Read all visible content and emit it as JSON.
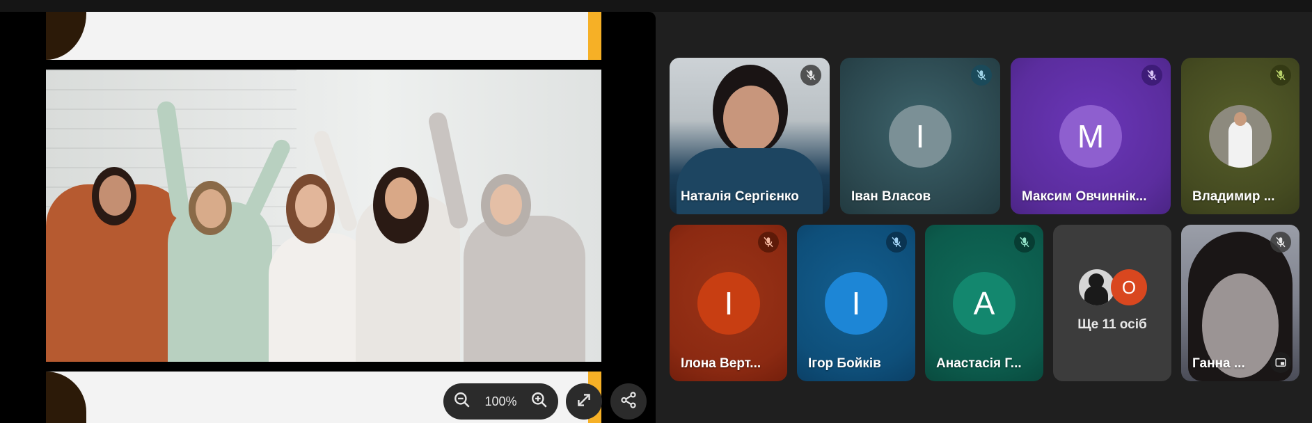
{
  "presentation": {
    "zoom_level": "100%",
    "colors": {
      "slide_bg": "#f3f3f3",
      "accent_orange": "#f6b026",
      "accent_brown": "#2c1a08"
    }
  },
  "controls": {
    "zoom_out_icon": "zoom-out-icon",
    "zoom_in_icon": "zoom-in-icon",
    "fullscreen_icon": "expand-icon",
    "share_icon": "share-icon"
  },
  "participants": [
    {
      "name": "Наталія Сергієнко",
      "type": "video",
      "muted": true
    },
    {
      "name": "Іван Власов",
      "initial": "І",
      "avatar_color": "#7b9096",
      "bg": "#2f4f56",
      "muted": true
    },
    {
      "name": "Максим Овчиннік...",
      "initial": "М",
      "avatar_color": "#8e5fcf",
      "bg": "#5b2d9e",
      "muted": true
    },
    {
      "name": "Владимир ...",
      "type": "photo",
      "bg": "#4a5224",
      "muted": true
    },
    {
      "name": "Ілона Верт...",
      "initial": "І",
      "avatar_color": "#c83e12",
      "bg": "#8c2a12",
      "muted": true
    },
    {
      "name": "Ігор Бойків",
      "initial": "І",
      "avatar_color": "#1d86d6",
      "bg": "#0e4f7a",
      "muted": true
    },
    {
      "name": "Анастасія Г...",
      "initial": "А",
      "avatar_color": "#13876e",
      "bg": "#0c5b4c",
      "muted": true
    },
    {
      "name": "Ганна ...",
      "type": "video",
      "muted": true
    }
  ],
  "more": {
    "label": "Ще 11 осіб",
    "badge_initial": "О",
    "badge_color": "#d9471f"
  }
}
